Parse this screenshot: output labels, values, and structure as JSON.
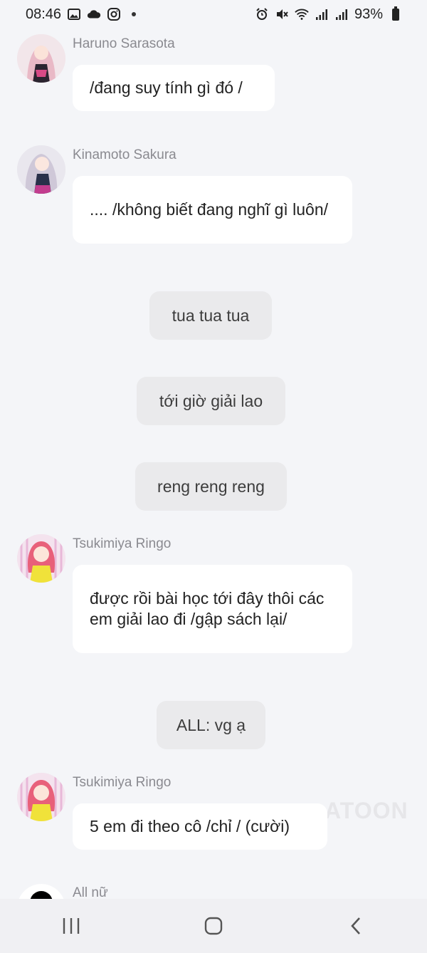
{
  "status_bar": {
    "time": "08:46",
    "battery": "93%",
    "left_icons": [
      "gallery-icon",
      "cloud-icon",
      "instagram-icon",
      "dot-icon"
    ],
    "right_icons": [
      "alarm-icon",
      "mute-icon",
      "wifi-icon",
      "signal-icon",
      "signal-icon",
      "battery-icon"
    ]
  },
  "messages": [
    {
      "sender": "Haruno Sarasota",
      "text": "/đang suy tính gì đó /"
    },
    {
      "sender": "Kinamoto Sakura",
      "text": ".... /không biết đang nghĩ gì luôn/"
    },
    {
      "sender": "Tsukimiya Ringo",
      "text": "được rồi bài học tới đây thôi các em giải lao đi /gập sách lại/"
    },
    {
      "sender": "Tsukimiya Ringo",
      "text": "5 em đi theo cô /chỉ / (cười)"
    },
    {
      "sender": "All nữ",
      "text": ""
    }
  ],
  "narration": [
    {
      "text": "tua tua tua"
    },
    {
      "text": "tới giờ giải lao"
    },
    {
      "text": "reng reng reng"
    },
    {
      "text": "ALL: vg ạ"
    }
  ],
  "watermark": "ATOON",
  "colors": {
    "background": "#f4f5f8",
    "bubble": "#ffffff",
    "narration_bubble": "#eaeaec",
    "sender_name": "#8a8a90"
  },
  "nav": [
    "recent-apps-icon",
    "home-icon",
    "back-icon"
  ]
}
